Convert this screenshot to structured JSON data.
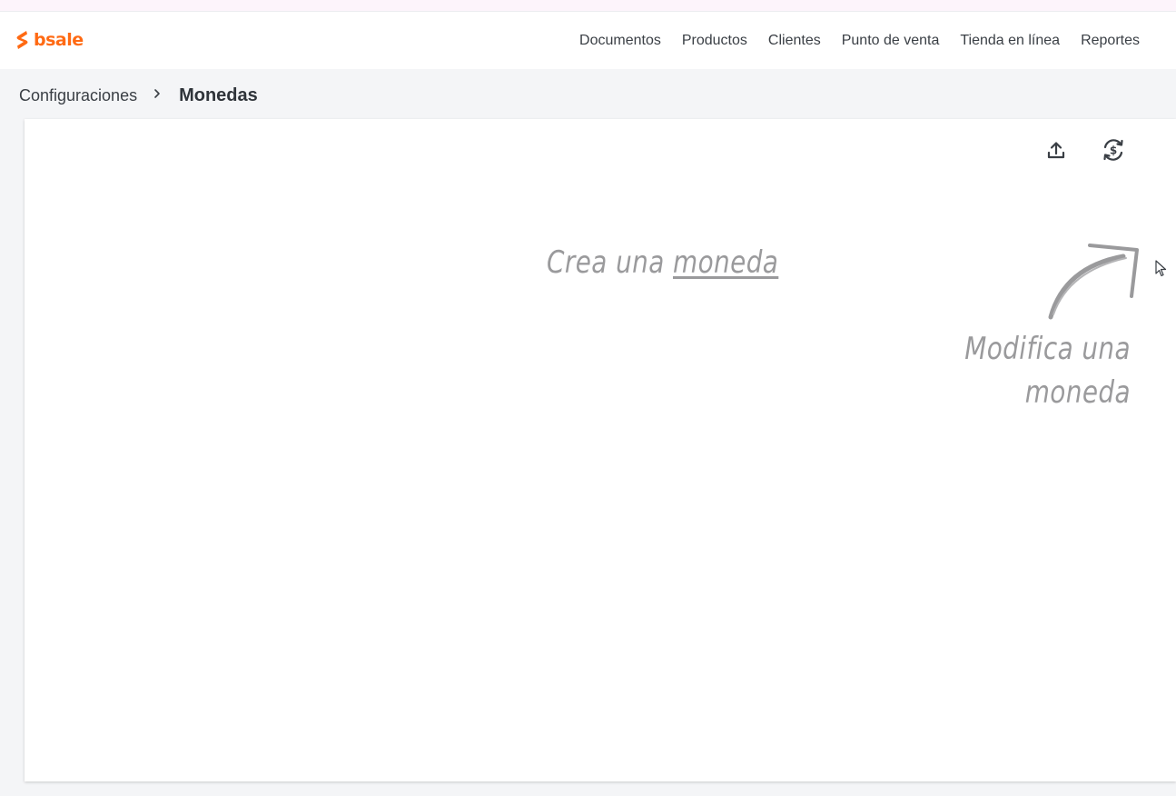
{
  "brand": {
    "name": "bsale",
    "color": "#ff6a13"
  },
  "nav": {
    "items": [
      {
        "label": "Documentos",
        "name": "nav-documentos"
      },
      {
        "label": "Productos",
        "name": "nav-productos"
      },
      {
        "label": "Clientes",
        "name": "nav-clientes"
      },
      {
        "label": "Punto de venta",
        "name": "nav-punto-de-venta"
      },
      {
        "label": "Tienda en línea",
        "name": "nav-tienda-en-linea"
      },
      {
        "label": "Reportes",
        "name": "nav-reportes"
      }
    ]
  },
  "breadcrumb": {
    "parent": "Configuraciones",
    "separator_icon": "chevron-right-icon",
    "current": "Monedas"
  },
  "toolbar": {
    "upload_icon": "upload-icon",
    "exchange_icon": "currency-exchange-icon"
  },
  "empty_state": {
    "create_prefix": "Crea una ",
    "create_link": "moneda",
    "modify_line1": "Modifica una",
    "modify_line2": "moneda"
  }
}
